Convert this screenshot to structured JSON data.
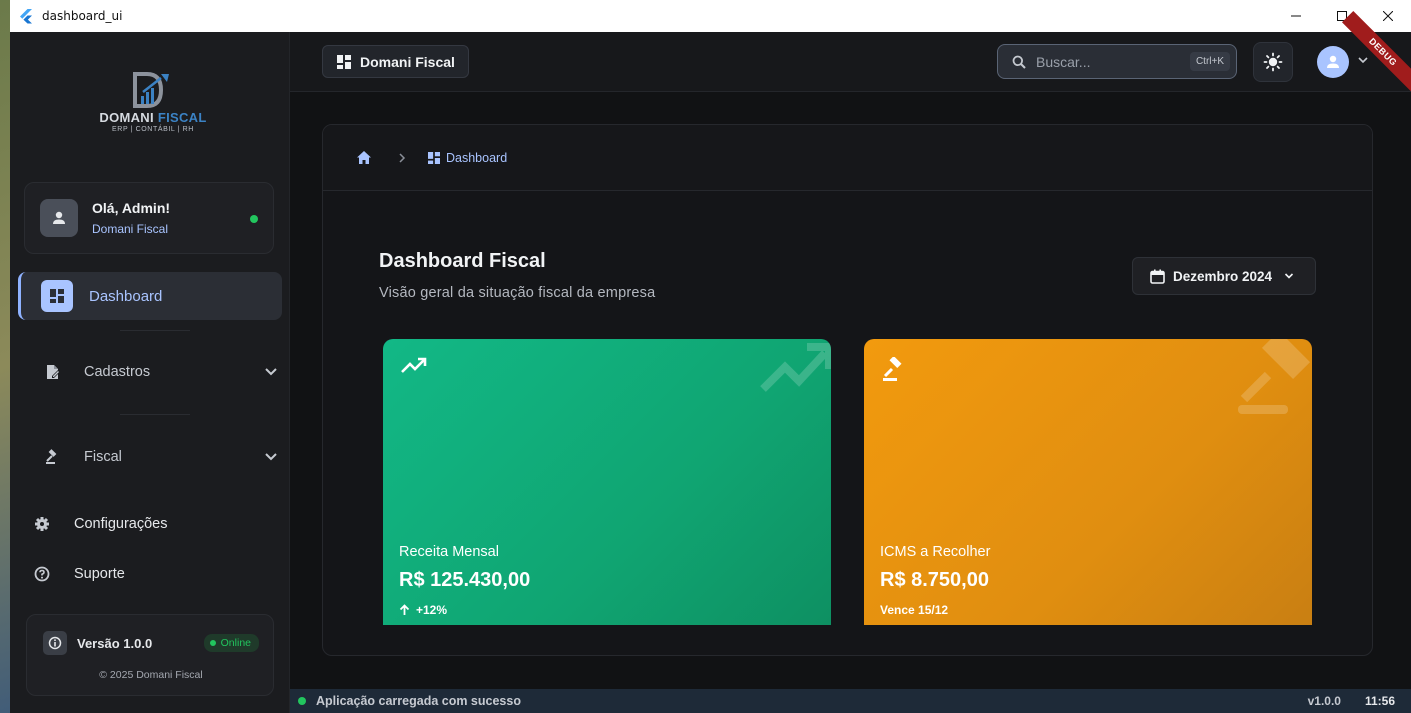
{
  "window": {
    "title": "dashboard_ui"
  },
  "logo": {
    "name_part1": "DOMANI",
    "name_part2": "FISCAL",
    "tagline": "ERP | CONTÁBIL | RH"
  },
  "user": {
    "greeting": "Olá, Admin!",
    "company": "Domani Fiscal"
  },
  "sidebar": {
    "items": [
      {
        "label": "Dashboard",
        "icon": "dashboard-icon",
        "active": true
      },
      {
        "label": "Cadastros",
        "icon": "document-edit-icon",
        "expandable": true
      },
      {
        "label": "Fiscal",
        "icon": "gavel-icon",
        "expandable": true
      },
      {
        "label": "Configurações",
        "icon": "gear-icon"
      },
      {
        "label": "Suporte",
        "icon": "help-icon"
      }
    ]
  },
  "version_card": {
    "version": "Versão 1.0.0",
    "status": "Online",
    "copyright": "© 2025 Domani Fiscal"
  },
  "topbar": {
    "brand": "Domani Fiscal",
    "search_placeholder": "Buscar...",
    "shortcut": "Ctrl+K",
    "debug_banner": "DEBUG"
  },
  "breadcrumb": {
    "current": "Dashboard"
  },
  "dashboard": {
    "title": "Dashboard Fiscal",
    "subtitle": "Visão geral da situação fiscal da empresa",
    "period": "Dezembro 2024"
  },
  "cards": [
    {
      "label": "Receita Mensal",
      "value": "R$ 125.430,00",
      "foot": "+12%",
      "color": "#12b886",
      "icon": "trending-up-icon"
    },
    {
      "label": "ICMS a Recolher",
      "value": "R$ 8.750,00",
      "foot": "Vence 15/12",
      "color": "#f29a0e",
      "icon": "gavel-icon"
    }
  ],
  "statusbar": {
    "message": "Aplicação carregada com sucesso",
    "version": "v1.0.0",
    "time": "11:56"
  },
  "colors": {
    "accent": "#a9c4ff",
    "success": "#22c55e",
    "bg": "#111214",
    "sidebar": "#1b1c1f"
  }
}
